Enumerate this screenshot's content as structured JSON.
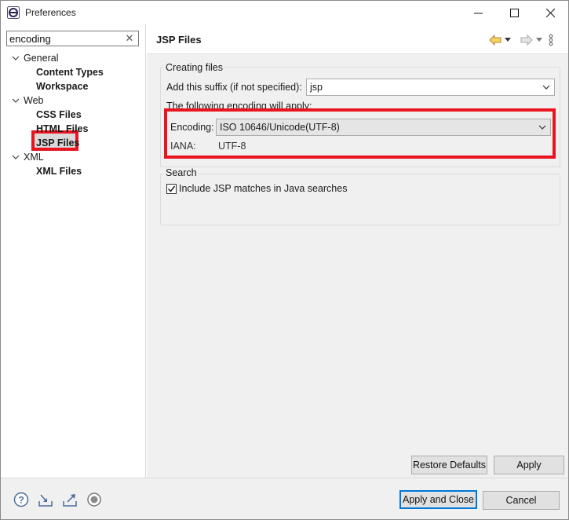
{
  "window": {
    "title": "Preferences"
  },
  "filter": {
    "value": "encoding"
  },
  "tree": {
    "items": [
      {
        "label": "General",
        "children": [
          "Content Types",
          "Workspace"
        ]
      },
      {
        "label": "Web",
        "children": [
          "CSS Files",
          "HTML Files",
          "JSP Files"
        ]
      },
      {
        "label": "XML",
        "children": [
          "XML Files"
        ]
      }
    ],
    "selected": "JSP Files"
  },
  "page": {
    "title": "JSP Files"
  },
  "creating_files": {
    "group_title": "Creating files",
    "suffix_label": "Add this suffix (if not specified):",
    "suffix_value": "jsp",
    "encoding_intro": "The following encoding will apply:",
    "encoding_label": "Encoding:",
    "encoding_value": "ISO 10646/Unicode(UTF-8)",
    "iana_label": "IANA:",
    "iana_value": "UTF-8"
  },
  "search": {
    "group_title": "Search",
    "checkbox_label": "Include JSP matches in Java searches",
    "checked": true
  },
  "buttons": {
    "restore_defaults": "Restore Defaults",
    "apply": "Apply",
    "apply_and_close": "Apply and Close",
    "cancel": "Cancel"
  },
  "colors": {
    "highlight": "#e8141f",
    "focus": "#0078d7",
    "selection": "#d9d9d9"
  },
  "icons": {
    "bottom_bar": [
      "help-icon",
      "import-icon",
      "export-icon",
      "oomph-record-icon"
    ],
    "header": [
      "back-arrow-icon",
      "forward-arrow-icon",
      "view-menu-icon"
    ]
  }
}
